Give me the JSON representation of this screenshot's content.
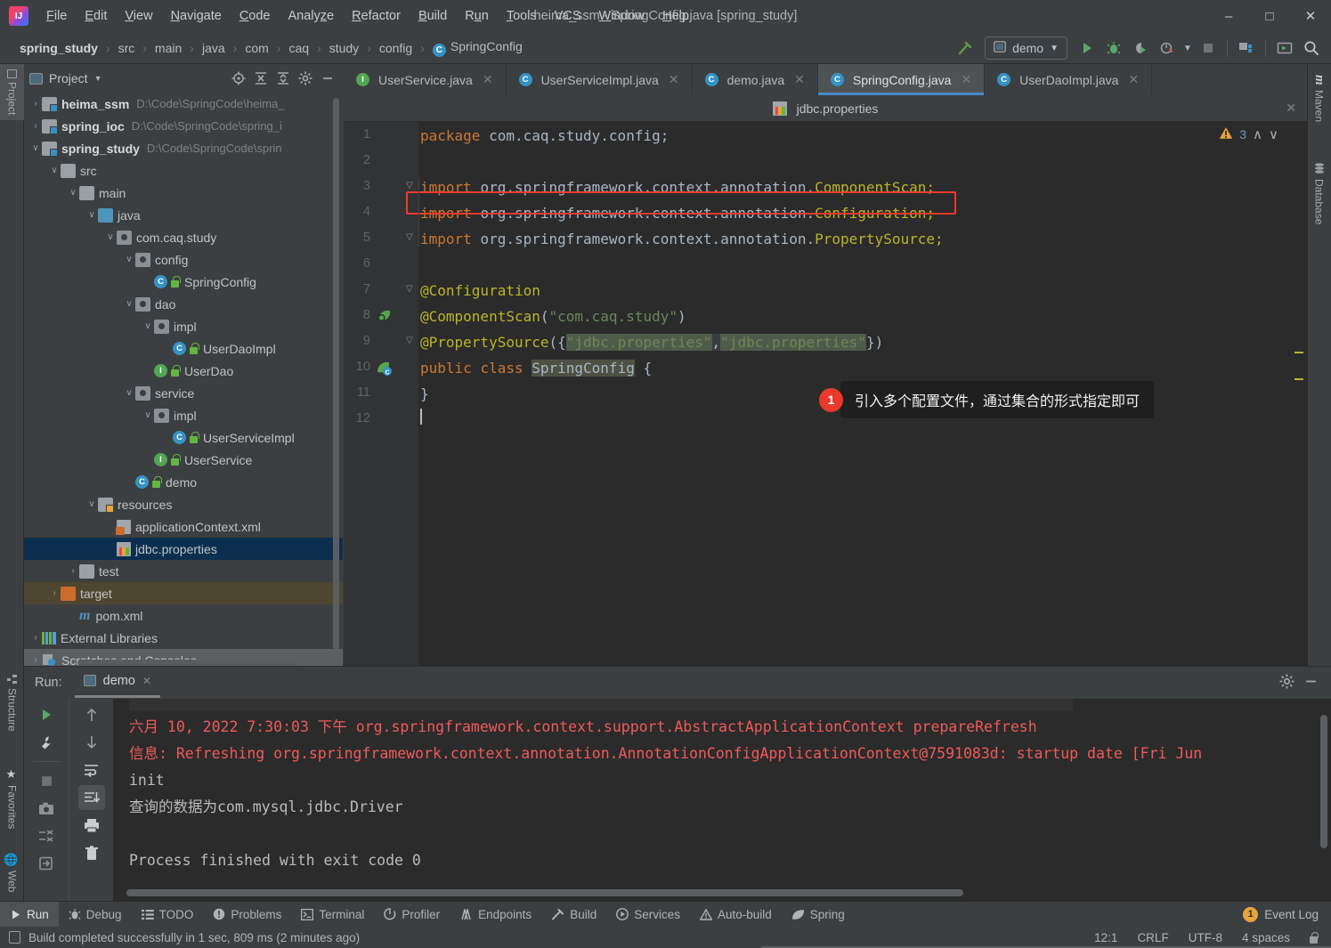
{
  "window": {
    "title": "heima_ssm - SpringConfig.java [spring_study]",
    "minimize": "–",
    "maximize": "□",
    "close": "✕"
  },
  "menubar": [
    {
      "label": "File",
      "mnemonic": "F"
    },
    {
      "label": "Edit",
      "mnemonic": "E"
    },
    {
      "label": "View",
      "mnemonic": "V"
    },
    {
      "label": "Navigate",
      "mnemonic": "N"
    },
    {
      "label": "Code",
      "mnemonic": "C"
    },
    {
      "label": "Analyze",
      "mnemonic": "z"
    },
    {
      "label": "Refactor",
      "mnemonic": "R"
    },
    {
      "label": "Build",
      "mnemonic": "B"
    },
    {
      "label": "Run",
      "mnemonic": "u"
    },
    {
      "label": "Tools",
      "mnemonic": "T"
    },
    {
      "label": "VCS",
      "mnemonic": ""
    },
    {
      "label": "Window",
      "mnemonic": "W"
    },
    {
      "label": "Help",
      "mnemonic": "H"
    }
  ],
  "breadcrumbs": [
    "spring_study",
    "src",
    "main",
    "java",
    "com",
    "caq",
    "study",
    "config",
    "SpringConfig"
  ],
  "toolbar": {
    "run_config": "demo",
    "icons": [
      "build-hammer-icon",
      "run-icon",
      "debug-icon",
      "run-coverage-icon",
      "profiler-icon",
      "stop-icon",
      "project-structure-icon",
      "select-in-icon",
      "search-everywhere-icon"
    ]
  },
  "left_tool_tabs": [
    "Project",
    "Structure",
    "Favorites",
    "Web"
  ],
  "right_tool_tabs": [
    "Maven",
    "Database"
  ],
  "project_panel": {
    "title": "Project",
    "header_icons": [
      "locate-icon",
      "expand-all-icon",
      "collapse-all-icon",
      "settings-gear-icon",
      "hide-icon"
    ],
    "tree": [
      {
        "indent": 0,
        "arrow": "›",
        "icon": "module",
        "label": "heima_ssm",
        "bold": true,
        "path": "D:\\Code\\SpringCode\\heima_"
      },
      {
        "indent": 0,
        "arrow": "›",
        "icon": "module",
        "label": "spring_ioc",
        "bold": true,
        "path": "D:\\Code\\SpringCode\\spring_i"
      },
      {
        "indent": 0,
        "arrow": "∨",
        "icon": "module",
        "label": "spring_study",
        "bold": true,
        "path": "D:\\Code\\SpringCode\\sprin"
      },
      {
        "indent": 1,
        "arrow": "∨",
        "icon": "folder",
        "label": "src",
        "bold": false,
        "path": ""
      },
      {
        "indent": 2,
        "arrow": "∨",
        "icon": "folder",
        "label": "main",
        "bold": false,
        "path": ""
      },
      {
        "indent": 3,
        "arrow": "∨",
        "icon": "folder-blue",
        "label": "java",
        "bold": false,
        "path": ""
      },
      {
        "indent": 4,
        "arrow": "∨",
        "icon": "package",
        "label": "com.caq.study",
        "bold": false,
        "path": ""
      },
      {
        "indent": 5,
        "arrow": "∨",
        "icon": "package",
        "label": "config",
        "bold": false,
        "path": ""
      },
      {
        "indent": 6,
        "arrow": "",
        "icon": "class",
        "label": "SpringConfig",
        "bold": false,
        "path": ""
      },
      {
        "indent": 5,
        "arrow": "∨",
        "icon": "package",
        "label": "dao",
        "bold": false,
        "path": ""
      },
      {
        "indent": 6,
        "arrow": "∨",
        "icon": "package",
        "label": "impl",
        "bold": false,
        "path": ""
      },
      {
        "indent": 7,
        "arrow": "",
        "icon": "class",
        "label": "UserDaoImpl",
        "bold": false,
        "path": ""
      },
      {
        "indent": 6,
        "arrow": "",
        "icon": "interface",
        "label": "UserDao",
        "bold": false,
        "path": ""
      },
      {
        "indent": 5,
        "arrow": "∨",
        "icon": "package",
        "label": "service",
        "bold": false,
        "path": ""
      },
      {
        "indent": 6,
        "arrow": "∨",
        "icon": "package",
        "label": "impl",
        "bold": false,
        "path": ""
      },
      {
        "indent": 7,
        "arrow": "",
        "icon": "class",
        "label": "UserServiceImpl",
        "bold": false,
        "path": ""
      },
      {
        "indent": 6,
        "arrow": "",
        "icon": "interface",
        "label": "UserService",
        "bold": false,
        "path": ""
      },
      {
        "indent": 5,
        "arrow": "",
        "icon": "runnable-class",
        "label": "demo",
        "bold": false,
        "path": ""
      },
      {
        "indent": 3,
        "arrow": "∨",
        "icon": "folder-resources",
        "label": "resources",
        "bold": false,
        "path": ""
      },
      {
        "indent": 4,
        "arrow": "",
        "icon": "xml",
        "label": "applicationContext.xml",
        "bold": false,
        "path": ""
      },
      {
        "indent": 4,
        "arrow": "",
        "icon": "properties",
        "label": "jdbc.properties",
        "bold": false,
        "path": "",
        "selected": true
      },
      {
        "indent": 2,
        "arrow": "›",
        "icon": "folder",
        "label": "test",
        "bold": false,
        "path": ""
      },
      {
        "indent": 1,
        "arrow": "›",
        "icon": "folder-orange",
        "label": "target",
        "bold": false,
        "path": "",
        "target": true
      },
      {
        "indent": 2,
        "arrow": "",
        "icon": "maven",
        "label": "pom.xml",
        "bold": false,
        "path": ""
      },
      {
        "indent": 0,
        "arrow": "›",
        "icon": "libraries",
        "label": "External Libraries",
        "bold": false,
        "path": ""
      },
      {
        "indent": 0,
        "arrow": "›",
        "icon": "scratches",
        "label": "Scratches and Consoles",
        "bold": false,
        "path": "",
        "scratch": true
      }
    ]
  },
  "editor": {
    "tabs": [
      {
        "label": "UserService.java",
        "icon": "interface",
        "active": false,
        "closable": true
      },
      {
        "label": "UserServiceImpl.java",
        "icon": "class",
        "active": false,
        "closable": true
      },
      {
        "label": "demo.java",
        "icon": "runnable-class",
        "active": false,
        "closable": true
      },
      {
        "label": "SpringConfig.java",
        "icon": "class",
        "active": true,
        "closable": true
      },
      {
        "label": "UserDaoImpl.java",
        "icon": "class",
        "active": false,
        "closable": true
      }
    ],
    "split_tab": {
      "label": "jdbc.properties",
      "icon": "properties",
      "close": "✕"
    },
    "warnings": {
      "count": "3",
      "icon": "warning-triangle-icon",
      "up": "∧",
      "down": "∨"
    },
    "line_numbers": [
      "1",
      "2",
      "3",
      "4",
      "5",
      "6",
      "7",
      "8",
      "9",
      "10",
      "11",
      "12"
    ],
    "code_lines": [
      {
        "n": 1,
        "segments": [
          {
            "t": "package ",
            "c": "k"
          },
          {
            "t": "com.caq.study.config;",
            "c": "pl"
          }
        ]
      },
      {
        "n": 2,
        "segments": []
      },
      {
        "n": 3,
        "segments": [
          {
            "t": "import ",
            "c": "k"
          },
          {
            "t": "org.springframework.context.annotation.",
            "c": "pl"
          },
          {
            "t": "ComponentScan;",
            "c": "an"
          }
        ]
      },
      {
        "n": 4,
        "segments": [
          {
            "t": "import ",
            "c": "k"
          },
          {
            "t": "org.springframework.context.annotation.",
            "c": "pl"
          },
          {
            "t": "Configuration;",
            "c": "an"
          }
        ]
      },
      {
        "n": 5,
        "segments": [
          {
            "t": "import ",
            "c": "k"
          },
          {
            "t": "org.springframework.context.annotation.",
            "c": "pl"
          },
          {
            "t": "PropertySource;",
            "c": "an"
          }
        ]
      },
      {
        "n": 6,
        "segments": []
      },
      {
        "n": 7,
        "segments": [
          {
            "t": "@Configuration",
            "c": "an"
          }
        ]
      },
      {
        "n": 8,
        "segments": [
          {
            "t": "@ComponentScan",
            "c": "an"
          },
          {
            "t": "(",
            "c": "pl"
          },
          {
            "t": "\"com.caq.study\"",
            "c": "st"
          },
          {
            "t": ")",
            "c": "pl"
          }
        ]
      },
      {
        "n": 9,
        "segments": [
          {
            "t": "@PropertySource",
            "c": "an"
          },
          {
            "t": "({",
            "c": "pl"
          },
          {
            "t": "\"jdbc.properties\"",
            "c": "st"
          },
          {
            "t": ",",
            "c": "pl"
          },
          {
            "t": "\"jdbc.properties\"",
            "c": "st"
          },
          {
            "t": "})",
            "c": "pl"
          }
        ]
      },
      {
        "n": 10,
        "segments": [
          {
            "t": "public ",
            "c": "k"
          },
          {
            "t": "class ",
            "c": "k"
          },
          {
            "t": "SpringConfig",
            "c": "cls"
          },
          {
            "t": " {",
            "c": "pl"
          }
        ]
      },
      {
        "n": 11,
        "segments": [
          {
            "t": "}",
            "c": "pl"
          }
        ]
      },
      {
        "n": 12,
        "segments": []
      }
    ],
    "annotation": {
      "badge": "1",
      "text": "引入多个配置文件，通过集合的形式指定即可"
    }
  },
  "run_panel": {
    "label": "Run:",
    "tab": "demo",
    "tab_close": "✕",
    "header_icons": [
      "settings-gear-icon",
      "hide-panel-icon"
    ],
    "side_icons_col1": [
      "rerun-icon",
      "settings-wrench-icon",
      "stop-icon",
      "screenshot-icon",
      "close-all-icon",
      "export-icon"
    ],
    "side_icons_col2": [
      "up-arrow-icon",
      "down-arrow-icon",
      "soft-wrap-icon",
      "scroll-to-end-icon",
      "print-icon",
      "trash-icon"
    ],
    "console_lines": [
      {
        "text": "六月 10, 2022 7:30:03 下午 org.springframework.context.support.AbstractApplicationContext prepareRefresh",
        "color": "red"
      },
      {
        "text": "信息: Refreshing org.springframework.context.annotation.AnnotationConfigApplicationContext@7591083d: startup date [Fri Jun",
        "color": "red"
      },
      {
        "text": "init",
        "color": "white"
      },
      {
        "text": "查询的数据为com.mysql.jdbc.Driver",
        "color": "white"
      },
      {
        "text": "",
        "color": "white"
      },
      {
        "text": "Process finished with exit code 0",
        "color": "white"
      }
    ]
  },
  "bottom_tabs": [
    {
      "label": "Run",
      "icon": "play-icon",
      "active": true
    },
    {
      "label": "Debug",
      "icon": "bug-icon",
      "active": false
    },
    {
      "label": "TODO",
      "icon": "list-icon",
      "active": false
    },
    {
      "label": "Problems",
      "icon": "exclamation-circle-icon",
      "active": false
    },
    {
      "label": "Terminal",
      "icon": "terminal-icon",
      "active": false
    },
    {
      "label": "Profiler",
      "icon": "profiler-icon",
      "active": false
    },
    {
      "label": "Endpoints",
      "icon": "endpoints-icon",
      "active": false
    },
    {
      "label": "Build",
      "icon": "hammer-icon",
      "active": false
    },
    {
      "label": "Services",
      "icon": "services-icon",
      "active": false
    },
    {
      "label": "Auto-build",
      "icon": "warning-triangle-icon",
      "active": false
    },
    {
      "label": "Spring",
      "icon": "spring-leaf-icon",
      "active": false
    }
  ],
  "event_log": {
    "badge": "1",
    "label": "Event Log"
  },
  "statusbar": {
    "message": "Build completed successfully in 1 sec, 809 ms (2 minutes ago)",
    "caret": "12:1",
    "line_sep": "CRLF",
    "encoding": "UTF-8",
    "indent": "4 spaces",
    "lock_icon": "unlocked-icon"
  },
  "colors": {
    "accent_blue": "#4a88c7",
    "selection": "#0d2f4f",
    "annotation_red": "#e8392b",
    "editor_bg": "#2b2b2b",
    "panel_bg": "#3c3f41",
    "string_green": "#6a8759",
    "keyword_orange": "#cc7832",
    "annotation_yellow": "#bbb529",
    "console_red": "#f05a5a"
  }
}
